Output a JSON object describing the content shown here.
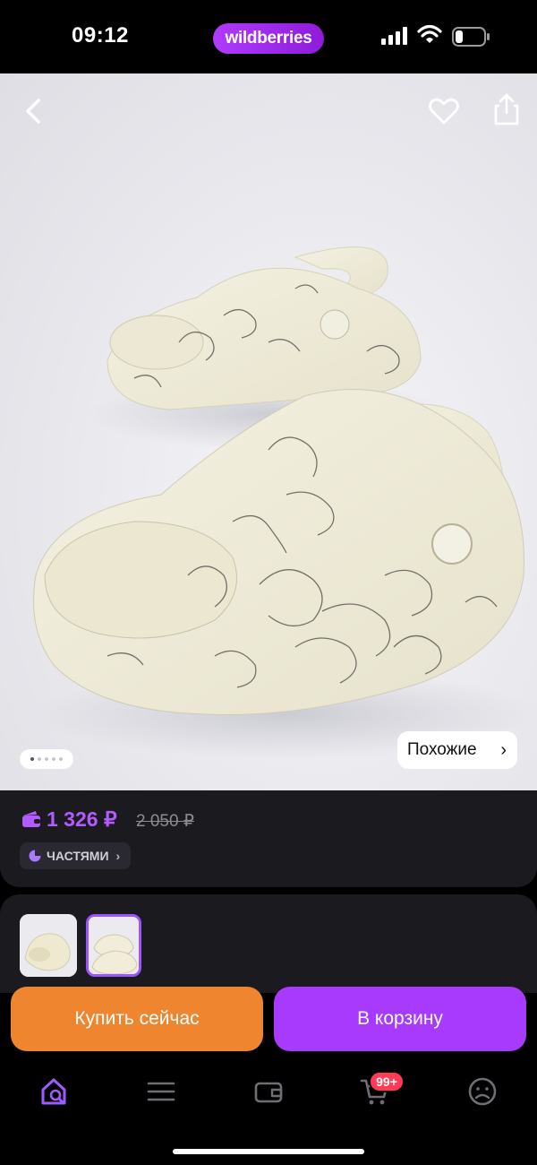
{
  "status_bar": {
    "time": "09:12",
    "brand": "wildberries"
  },
  "product_image": {
    "similar_label": "Похожие",
    "carousel_count": 5,
    "carousel_active": 1
  },
  "price": {
    "current": "1 326 ₽",
    "old": "2 050 ₽",
    "installments_label": "ЧАСТЯМИ"
  },
  "actions": {
    "buy_now": "Купить сейчас",
    "add_to_cart": "В корзину"
  },
  "bottom_nav": {
    "cart_badge": "99+"
  },
  "colors": {
    "accent": "#a73afd",
    "price": "#b25cff",
    "buy_now": "#f0852f",
    "badge": "#ff3b55"
  }
}
